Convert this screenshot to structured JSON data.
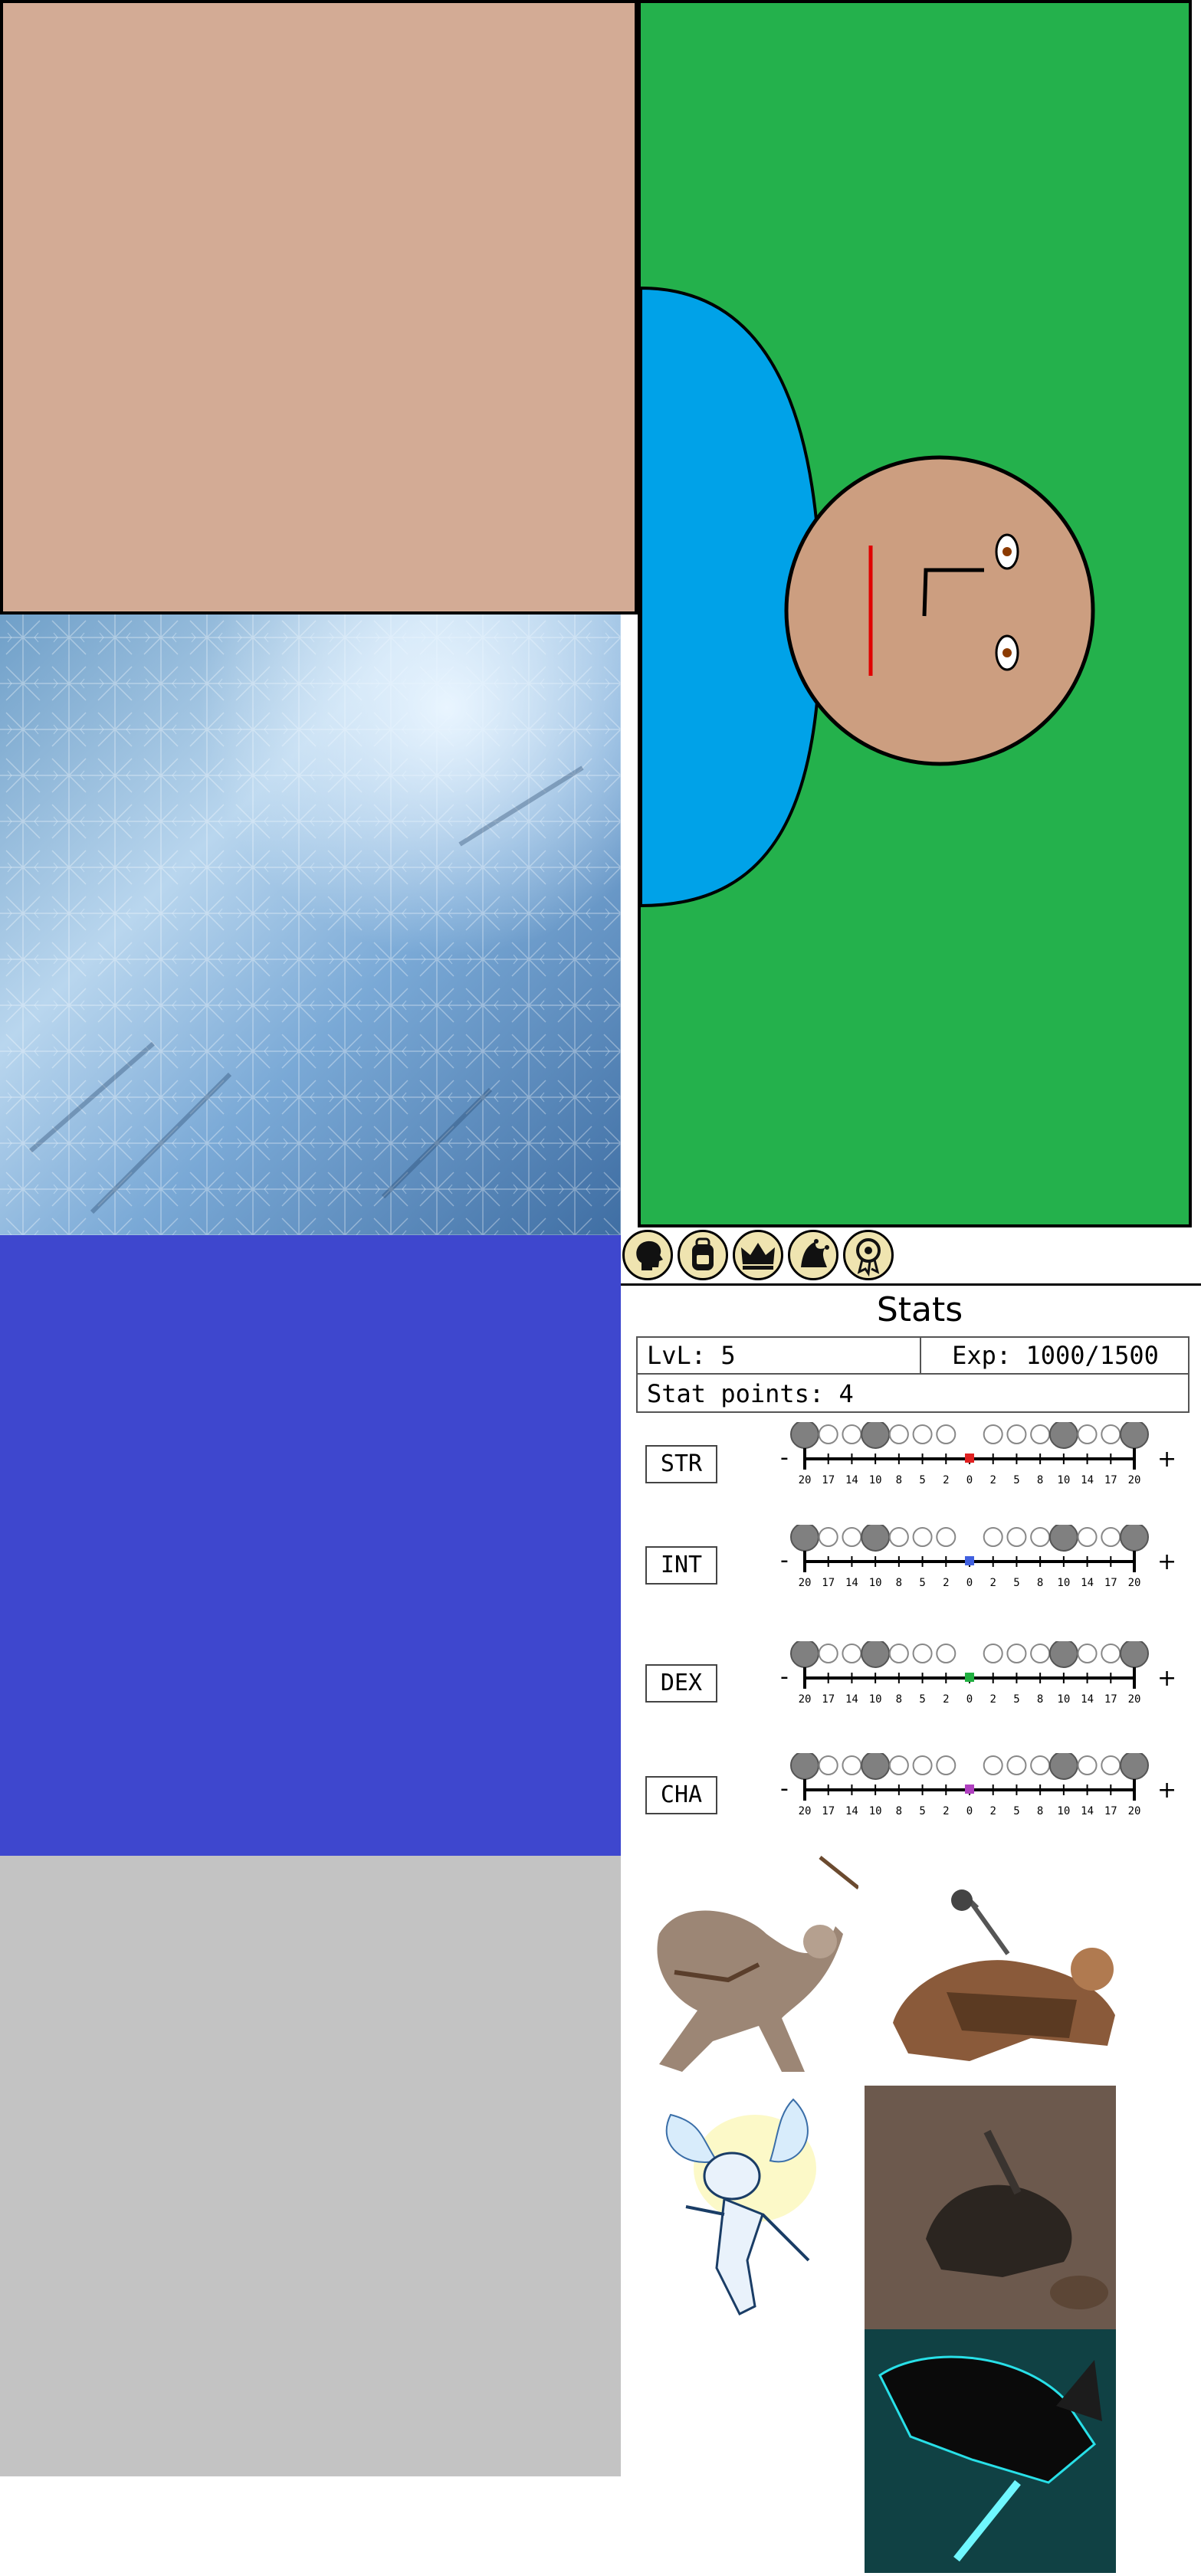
{
  "tabs": [
    {
      "name": "character-tab",
      "icon": "head-silhouette-icon"
    },
    {
      "name": "inventory-tab",
      "icon": "backpack-icon"
    },
    {
      "name": "title-tab",
      "icon": "crown-icon"
    },
    {
      "name": "equipment-tab",
      "icon": "jester-hat-icon"
    },
    {
      "name": "achievements-tab",
      "icon": "award-ribbon-icon"
    }
  ],
  "stats_panel": {
    "title": "Stats",
    "level": "LvL: 5",
    "exp": "Exp: 1000/1500",
    "stat_points": "Stat points: 4",
    "minus": "-",
    "plus": "+",
    "scale_labels": [
      "20",
      "17",
      "14",
      "10",
      "8",
      "5",
      "2",
      "0",
      "2",
      "5",
      "8",
      "10",
      "14",
      "17",
      "20"
    ],
    "stats": [
      {
        "label": "STR",
        "value": 0,
        "color": "#e02020"
      },
      {
        "label": "INT",
        "value": 0,
        "color": "#4060e0"
      },
      {
        "label": "DEX",
        "value": 0,
        "color": "#20b040"
      },
      {
        "label": "CHA",
        "value": 0,
        "color": "#b040c0"
      }
    ]
  },
  "panels": {
    "skin_color": "#d3ab95",
    "avatar_background": "#24b14c",
    "shirt_color": "#00a2e8",
    "blue_panel": "#3e47ce",
    "grey_panel": "#c3c3c3"
  },
  "character_images": [
    "werewolf-archer",
    "dwarf-barbarian",
    "pixie-fairy",
    "armored-knight",
    "cyber-warrior"
  ]
}
